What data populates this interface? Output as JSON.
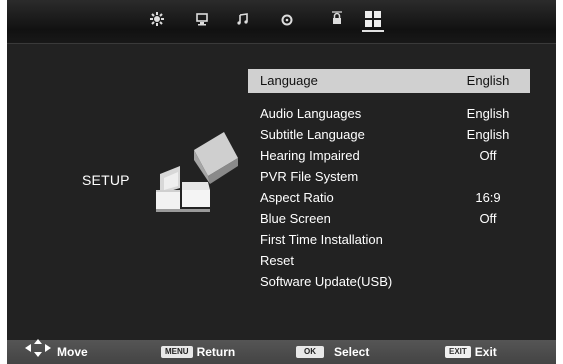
{
  "topbar": {
    "icons": [
      "picture-icon",
      "monitor-icon",
      "music-icon",
      "timer-icon",
      "lock-icon",
      "setup-grid-icon"
    ],
    "active_icon": "setup-grid-icon"
  },
  "setup": {
    "label": "SETUP"
  },
  "menu": {
    "items": [
      {
        "label": "Language",
        "value": "English",
        "selected": true
      },
      {
        "label": "Audio Languages",
        "value": "English"
      },
      {
        "label": "Subtitle Language",
        "value": "English"
      },
      {
        "label": "Hearing Impaired",
        "value": "Off"
      },
      {
        "label": "PVR File System",
        "value": ""
      },
      {
        "label": "Aspect Ratio",
        "value": "16:9"
      },
      {
        "label": "Blue Screen",
        "value": "Off"
      },
      {
        "label": "First Time Installation",
        "value": ""
      },
      {
        "label": "Reset",
        "value": ""
      },
      {
        "label": "Software Update(USB)",
        "value": ""
      }
    ]
  },
  "hints": {
    "move": "Move",
    "menu_key": "MENU",
    "return": "Return",
    "ok_key": "OK",
    "select": "Select",
    "exit_key": "EXIT",
    "exit": "Exit"
  },
  "colors": {
    "background": "#222222",
    "highlight": "#d0d0d0",
    "text": "#ffffff"
  }
}
